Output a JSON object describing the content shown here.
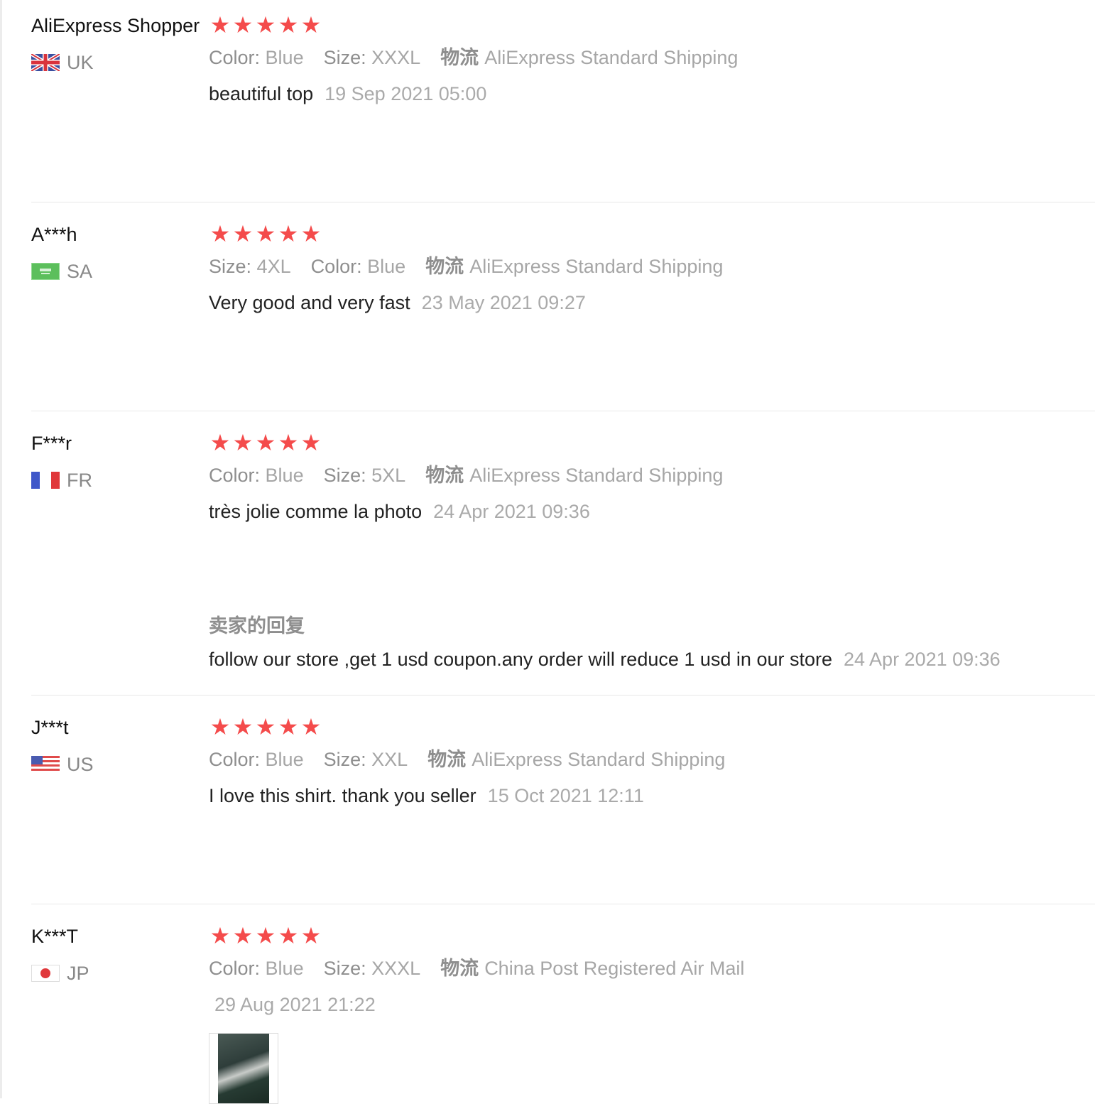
{
  "colors": {
    "star": "#f44b4b",
    "muted": "#999999",
    "text": "#222222",
    "divider": "#e8e8e8"
  },
  "reviews": [
    {
      "user": "AliExpress Shopper",
      "country": "UK",
      "flag_icon": "uk-flag-icon",
      "rating": 5,
      "attrs": [
        {
          "key": "Color:",
          "value": "Blue"
        },
        {
          "key": "Size:",
          "value": "XXXL"
        }
      ],
      "shipping_key": "物流",
      "shipping_value": "AliExpress Standard Shipping",
      "feedback": "beautiful top",
      "time": "19 Sep 2021 05:00"
    },
    {
      "user": "A***h",
      "country": "SA",
      "flag_icon": "sa-flag-icon",
      "rating": 5,
      "attrs": [
        {
          "key": "Size:",
          "value": "4XL"
        },
        {
          "key": "Color:",
          "value": "Blue"
        }
      ],
      "shipping_key": "物流",
      "shipping_value": "AliExpress Standard Shipping",
      "feedback": "Very good and very fast",
      "time": "23 May 2021 09:27"
    },
    {
      "user": "F***r",
      "country": "FR",
      "flag_icon": "fr-flag-icon",
      "rating": 5,
      "attrs": [
        {
          "key": "Color:",
          "value": "Blue"
        },
        {
          "key": "Size:",
          "value": "5XL"
        }
      ],
      "shipping_key": "物流",
      "shipping_value": "AliExpress Standard Shipping",
      "feedback": "très jolie comme la photo",
      "time": "24 Apr 2021 09:36",
      "seller_reply_title": "卖家的回复",
      "seller_reply": "follow our store ,get 1 usd coupon.any order will reduce 1 usd in our store",
      "seller_reply_time": "24 Apr 2021 09:36"
    },
    {
      "user": "J***t",
      "country": "US",
      "flag_icon": "us-flag-icon",
      "rating": 5,
      "attrs": [
        {
          "key": "Color:",
          "value": "Blue"
        },
        {
          "key": "Size:",
          "value": "XXL"
        }
      ],
      "shipping_key": "物流",
      "shipping_value": "AliExpress Standard Shipping",
      "feedback": "I love this shirt. thank you seller",
      "time": "15 Oct 2021 12:11"
    },
    {
      "user": "K***T",
      "country": "JP",
      "flag_icon": "jp-flag-icon",
      "rating": 5,
      "attrs": [
        {
          "key": "Color:",
          "value": "Blue"
        },
        {
          "key": "Size:",
          "value": "XXXL"
        }
      ],
      "shipping_key": "物流",
      "shipping_value": "China Post Registered Air Mail",
      "feedback": "",
      "time": "29 Aug 2021 21:22"
    }
  ]
}
